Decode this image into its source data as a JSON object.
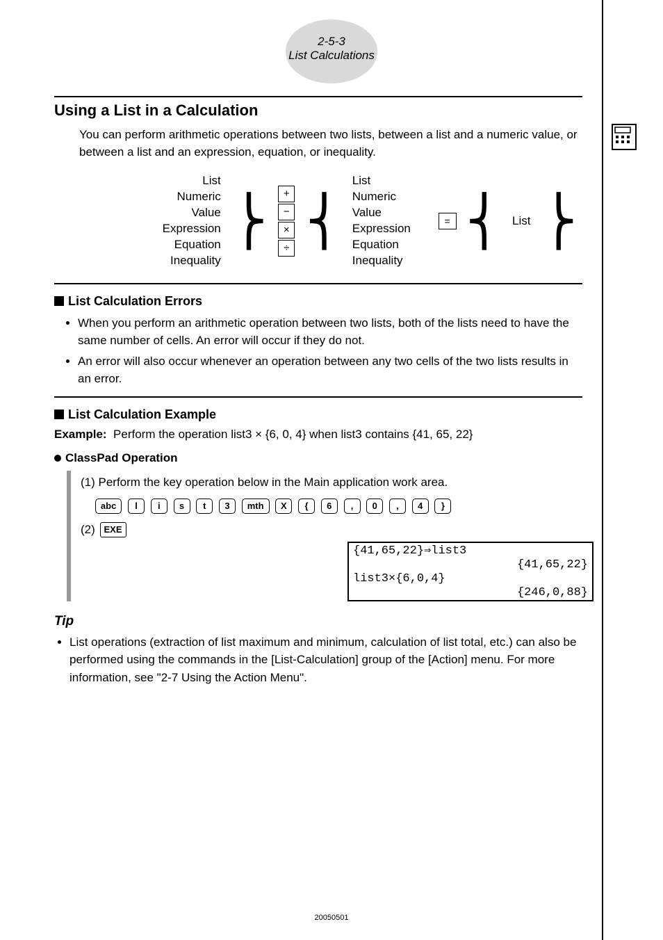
{
  "header": {
    "line1": "2-5-3",
    "line2": "List Calculations"
  },
  "title": "Using a List in a Calculation",
  "lead": "You can perform arithmetic operations between two lists, between a list and a numeric value, or between a list and an expression, equation, or inequality.",
  "diagram": {
    "left": [
      "List",
      "Numeric Value",
      "Expression",
      "Equation",
      "Inequality"
    ],
    "ops": [
      "+",
      "−",
      "×",
      "÷"
    ],
    "right": [
      "List",
      "Numeric Value",
      "Expression",
      "Equation",
      "Inequality"
    ],
    "eq": "=",
    "result": "List"
  },
  "errors": {
    "heading": "List Calculation Errors",
    "items": [
      "When you perform an arithmetic operation between two lists, both of the lists need to have the same number of cells. An error will occur if they do not.",
      "An error will also occur whenever an operation between any two cells of the two lists results in an error."
    ]
  },
  "example": {
    "heading": "List Calculation Example",
    "label": "Example:",
    "text": "Perform the operation list3 × {6, 0, 4} when list3 contains {41, 65, 22}"
  },
  "operation": {
    "heading": "ClassPad Operation",
    "step1": "(1) Perform the key operation below in the Main application work area.",
    "keys": [
      "abc",
      "l",
      "i",
      "s",
      "t",
      "3",
      "mth",
      "X",
      "{",
      "6",
      ",",
      "0",
      ",",
      "4",
      "}"
    ],
    "step2": "(2)",
    "step2key": "EXE"
  },
  "screen": {
    "r1l": "{41,65,22}⇒list3",
    "r1r": "",
    "r2l": "",
    "r2r": "{41,65,22}",
    "r3l": "list3×{6,0,4}",
    "r3r": "",
    "r4l": "",
    "r4r": "{246,0,88}"
  },
  "tip": {
    "heading": "Tip",
    "item": "List operations (extraction of list maximum and minimum, calculation of list total, etc.) can also be performed using the commands in the [List-Calculation] group of the [Action] menu. For more information, see \"2-7 Using the Action Menu\"."
  },
  "footer": "20050501",
  "sidebar_icon": "calculator-grid-icon"
}
